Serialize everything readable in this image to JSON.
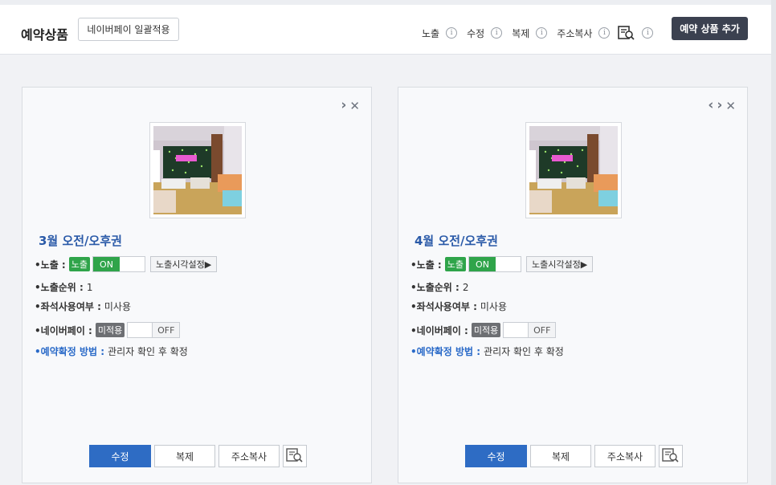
{
  "header": {
    "title": "예약상품",
    "naverpay_bulk_label": "네이버페이 일괄적용",
    "tools": [
      {
        "label": "노출",
        "icon": "info-icon"
      },
      {
        "label": "수정",
        "icon": "info-icon"
      },
      {
        "label": "복제",
        "icon": "info-icon"
      },
      {
        "label": "주소복사",
        "icon": "info-icon"
      }
    ],
    "preview_icon": "document-search-icon",
    "info_glyph": "i",
    "add_product_label": "예약 상품 추가"
  },
  "cards": [
    {
      "nav_prev": "",
      "nav_next": "›",
      "close": "✕",
      "name": "3월 오전/오후권",
      "exposure_label": "•노출 :",
      "exposure_badge": "노출",
      "exposure_toggle": "ON",
      "exposure_time_button": "노출시각설정▶",
      "rank_label": "•노출순위 :",
      "rank_value": "1",
      "seat_label": "•좌석사용여부 :",
      "seat_value": "미사용",
      "naverpay_label": "•네이버페이 :",
      "naverpay_badge": "미적용",
      "naverpay_toggle": "OFF",
      "confirm_label": "•예약확정 방법 :",
      "confirm_value": "관리자 확인 후 확정",
      "buttons": {
        "edit": "수정",
        "copy": "복제",
        "address": "주소복사"
      }
    },
    {
      "nav_prev": "‹",
      "nav_next": "›",
      "close": "✕",
      "name": "4월 오전/오후권",
      "exposure_label": "•노출 :",
      "exposure_badge": "노출",
      "exposure_toggle": "ON",
      "exposure_time_button": "노출시각설정▶",
      "rank_label": "•노출순위 :",
      "rank_value": "2",
      "seat_label": "•좌석사용여부 :",
      "seat_value": "미사용",
      "naverpay_label": "•네이버페이 :",
      "naverpay_badge": "미적용",
      "naverpay_toggle": "OFF",
      "confirm_label": "•예약확정 방법 :",
      "confirm_value": "관리자 확인 후 확정",
      "buttons": {
        "edit": "수정",
        "copy": "복제",
        "address": "주소복사"
      }
    }
  ],
  "colors": {
    "primary_button": "#2e6cc4",
    "toggle_on": "#2fa44a",
    "product_name": "#2a5aa8",
    "dark_button": "#3b4150"
  }
}
